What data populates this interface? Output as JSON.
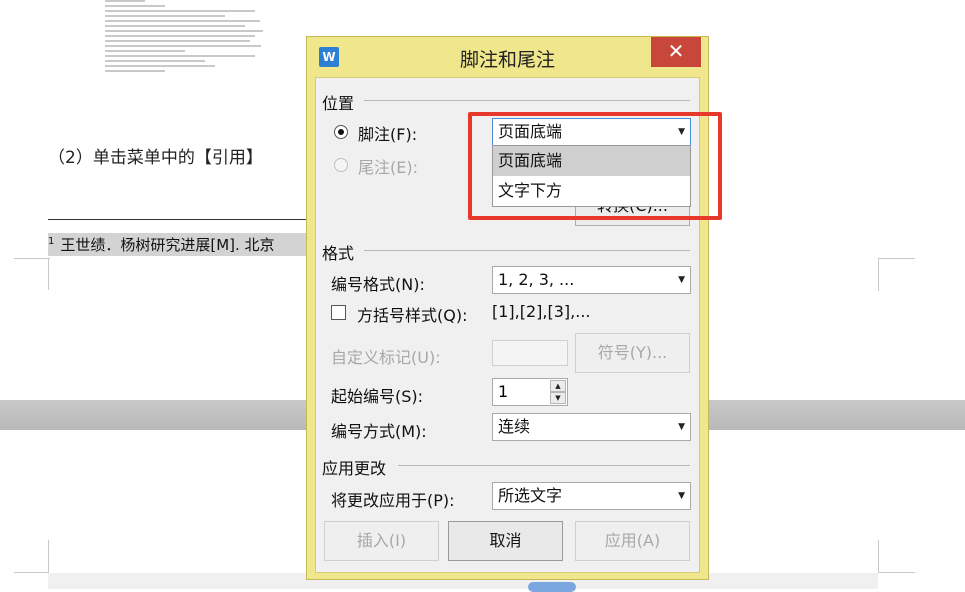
{
  "document": {
    "step_text": "（2）单击菜单中的【引用】",
    "footnote_number": "1",
    "footnote_text": "王世绩．杨树研究进展[M]. 北京"
  },
  "dialog": {
    "title": "脚注和尾注",
    "app_icon_letter": "W",
    "close_glyph": "✕",
    "position_group": {
      "title": "位置",
      "footnote_label": "脚注(F):",
      "endnote_label": "尾注(E):",
      "footnote_location": "页面底端",
      "convert_button": "转换(C)...",
      "dropdown_options": [
        "页面底端",
        "文字下方"
      ]
    },
    "format_group": {
      "title": "格式",
      "number_format_label": "编号格式(N):",
      "number_format_value": "1, 2, 3, ...",
      "bracket_style_label": "方括号样式(Q):",
      "bracket_style_sample": "[1],[2],[3],...",
      "custom_mark_label": "自定义标记(U):",
      "symbol_button": "符号(Y)...",
      "start_at_label": "起始编号(S):",
      "start_at_value": "1",
      "numbering_label": "编号方式(M):",
      "numbering_value": "连续"
    },
    "apply_group": {
      "title": "应用更改",
      "apply_to_label": "将更改应用于(P):",
      "apply_to_value": "所选文字"
    },
    "buttons": {
      "insert": "插入(I)",
      "cancel": "取消",
      "apply": "应用(A)"
    }
  },
  "colors": {
    "dialog_frame": "#f0e68c",
    "close_button": "#c8463a",
    "highlight_box": "#e8372b",
    "app_icon": "#2d7fd3"
  }
}
